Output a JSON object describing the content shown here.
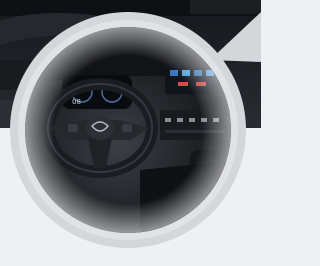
{
  "image": {
    "subject": "car-dashboard",
    "background_color": "#eef0f4",
    "ring_color": "#d4d6da",
    "bubble_color": "#e8e9ec"
  },
  "cluster": {
    "speed_readout": "08"
  }
}
